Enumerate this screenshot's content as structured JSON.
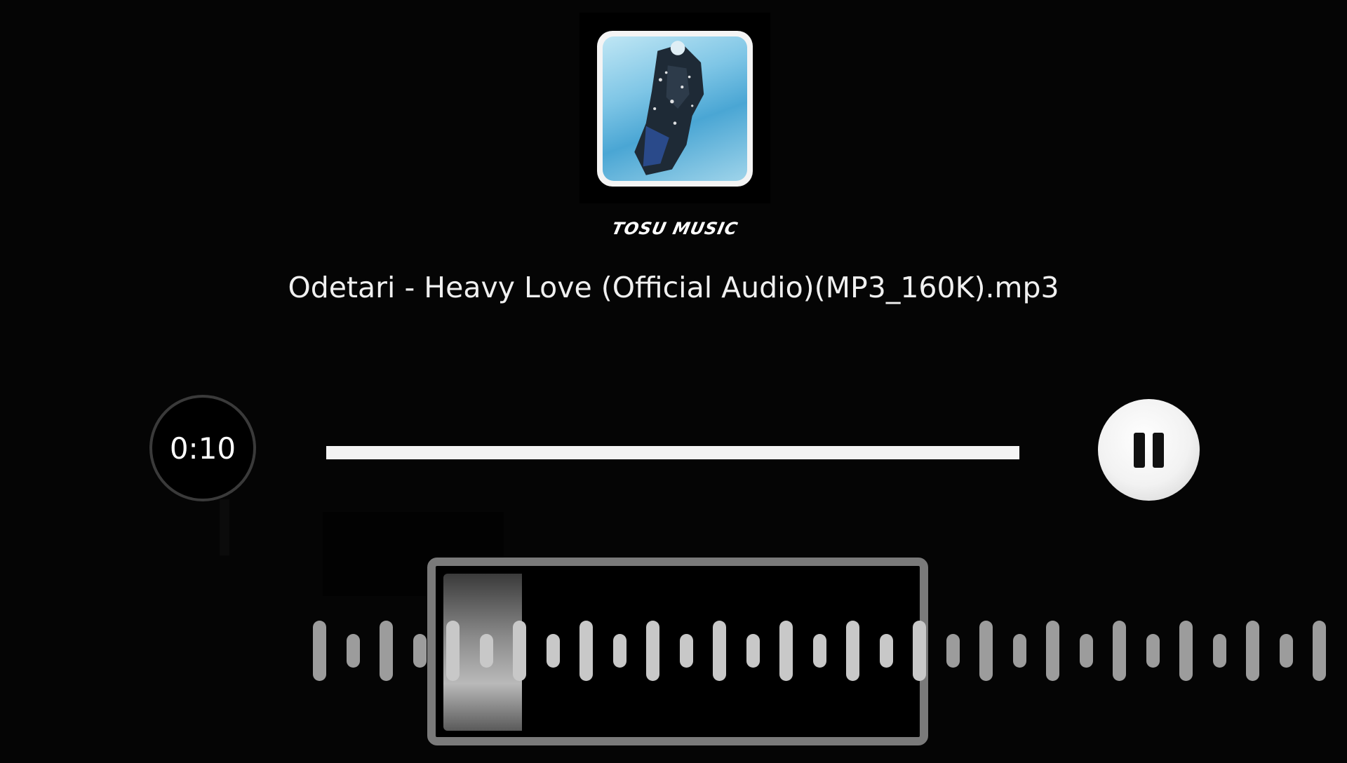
{
  "album": {
    "art_icon": "album-cover-photo"
  },
  "brand": {
    "logo_text": "TOSU MUSIC"
  },
  "track": {
    "title": "Odetari - Heavy Love (Official Audio)(MP3_160K).mp3"
  },
  "player": {
    "elapsed": "0:10",
    "progress_fraction": 1.0,
    "state": "playing",
    "pause_icon": "pause-icon"
  },
  "waveform": {
    "icon": "waveform-bars"
  },
  "colors": {
    "background": "#050505",
    "progress_fill": "#f4f4f4",
    "button_bg": "#f2f2f2",
    "wave_bar": "#9c9c9c",
    "selection_frame": "#7a7a7a"
  }
}
